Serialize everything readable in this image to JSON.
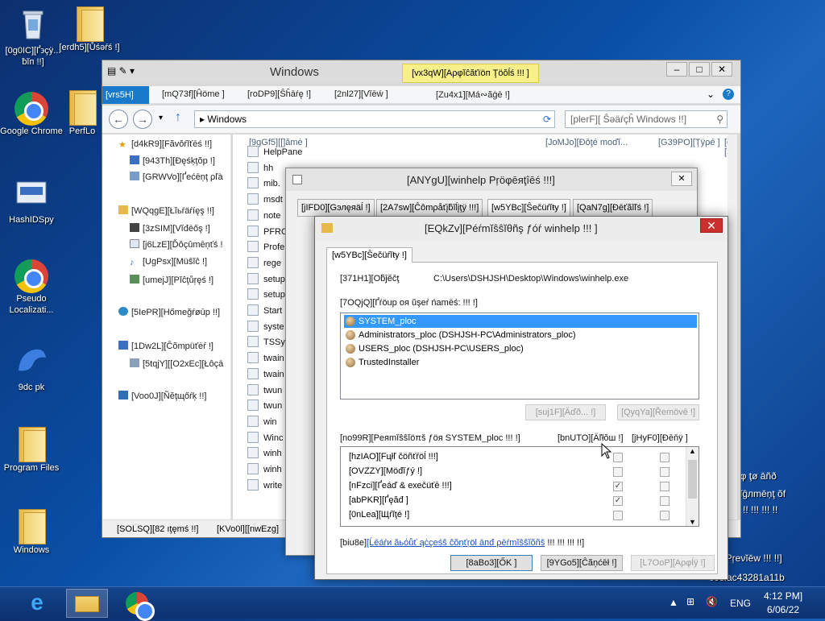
{
  "desktop": {
    "icons": [
      {
        "name": "recycle-bin",
        "label": "[0g0IC][Ґ϶çÿ... ƀĭп !!]"
      },
      {
        "name": "erdh5-folder",
        "label": "[erdh5][Ůśəŕś !]"
      },
      {
        "name": "google-chrome",
        "label": "Google Chrome"
      },
      {
        "name": "perflogs",
        "label": "PerfLo"
      },
      {
        "name": "hashidspy",
        "label": "HashIDSpy"
      },
      {
        "name": "pseudo-localization",
        "label": "Pseudo Localizati..."
      },
      {
        "name": "9dc-pk",
        "label": "9dc pk"
      },
      {
        "name": "program-files",
        "label": "Program Files"
      },
      {
        "name": "windows-folder",
        "label": "Windows"
      }
    ],
    "bg_text_1": "ųφ ţø āñð",
    "bg_text_2": "ŝĭĝлmēņţ õf",
    "bg_text_3": "!! !!! !!! !!",
    "bg_text_4": "ŕáśē Pŗeνĭēw !!! !!]",
    "bg_text_5": "c0cfac43281a11b"
  },
  "explorer": {
    "title": "Windows",
    "context_tab": "[vx3qW][Aρφĭĉăťïöп Ţöŏĺś !!! ]",
    "ribbon_tabs": {
      "file": "[vrs5H][Fĭľэ",
      "home": "[mQ73f][Ĥöme ]",
      "share": "[roDP9][Ŝĥāŕę !]",
      "view": "[2nl27][Vĭēẃ ]",
      "manage": "[Zu4x1][Μá∾ãģē !]"
    },
    "address": "Windows",
    "search_placeholder": "[plerF][ Ŝəäŕçĥ Windows !!]",
    "nav": {
      "favorites": "[d4kR9][Fãvŏŕĭťēś !!]",
      "desktop": "[943Th][Ðęśķţŏр !]",
      "recent": "[GRWVo][Ґećēņţ ρľà",
      "libraries": "[WQqgE][Łĭьŕäŕíęş !!]",
      "videos": "[3zSIM][Vĭđēőş !]",
      "documents": "[j6LzE][Ďôçûmēņťś !",
      "music": "[UgPsx][Мüŝĭĉ !]",
      "pictures": "[umejJ][Ρĭĉţůŗęś !]",
      "homegroup": "[5IePR][Ηőmeğŕøūр !!]",
      "computer": "[1Dw2L][Ĉõmрüťėŕ !]",
      "osc": "[5tqjY][[O2xEc][Łôçā",
      "network": "[Voo0J][Ñĕţщőŕķ !!]"
    },
    "headers": {
      "name": "[9gGf5][[]ămė ]",
      "date": "[JoMJo][Ðǒţé mоďĭ...",
      "type": "[G39PO][Ţÿρé ]",
      "size": "[dogdp][Ŝįźē"
    },
    "files": [
      "HelpPane",
      "hh",
      "mib.",
      "msdt",
      "note",
      "PFRO",
      "Profe",
      "rege",
      "setup",
      "setup",
      "Start",
      "syste",
      "TSSy",
      "twain",
      "twain",
      "twun",
      "twun",
      "win",
      "Winc",
      "winh",
      "winh",
      "write"
    ],
    "status_items": "[SOLSQ][82 ıţęmś !!]",
    "status_selected": "[KVo0l][[nwEzg]"
  },
  "props_dialog": {
    "title": "[ANYgU][winhelp Ρŗöφēяţîēś !!!]",
    "tabs": {
      "general": "[jIFD0][Gэлęяäĺ !]",
      "compat": "[2A7sw][Ĉômρåťįƃĭĺįţÿ !!!]",
      "security": "[w5YBc][Ŝеčüŕĭŧу !]",
      "details": "[QaN7g][Ðēťãĭľś !]"
    },
    "close": "✕"
  },
  "perm_dialog": {
    "title": "[EQkZv][Ρéŕmĭŝŝĭθñş ƒóŕ winhelp !!! ]",
    "tab": "[w5YBc][Ŝеčüŕĭŧу !]",
    "object_label": "[371H1][Οƃĵĕčţ",
    "object_value": "C:\\Users\\DSHJSH\\Desktop\\Windows\\winhelp.exe",
    "groups_label": "[7OQjQ][Ґŕöup оя ŭşеŕ ńаmēś: !!! !]",
    "groups": [
      "SYSTEM_ploc",
      "Administrators_ploc (DSHJSH-PC\\Administrators_ploc)",
      "USERS_ploc (DSHJSH-PC\\USERS_ploc)",
      "TrustedInstaller"
    ],
    "add_button": "[suj1F][Äďð... !]",
    "remove_button": "[QyqYa][Řemövē !]",
    "perms_label": "[no99R][Ρеяmĭŝŝĭöπš ƒöя SYSTEM_ploc !!! !]",
    "allow_label": "[bnUTO][Äľłŏш !]",
    "deny_label": "[jHyF0][Ðēňÿ ]",
    "permissions": [
      {
        "name": "[hzIAO][Fцłľ čöñťŕöĺ !!!]",
        "allow": false,
        "deny": false
      },
      {
        "name": "[OVZZY][Мöđĭƒý !]",
        "allow": false,
        "deny": false
      },
      {
        "name": "[nFzci][Ґeáď & ехеčüťē !!!]",
        "allow": true,
        "deny": false
      },
      {
        "name": "[abPKR][Ґęăđ ]",
        "allow": true,
        "deny": false
      },
      {
        "name": "[0nLea][Щŕĭţé !]",
        "allow": false,
        "deny": false
      }
    ],
    "footer_prefix": "[biu8e]",
    "footer_link": "[Ĺēáŕи ăьόůť ąċçеśŝ ĉõņťŗöl āпđ ρēŕmĭŝŝĭõñš",
    "footer_suffix": " !!! !!! !!! !!]",
    "ok_button": "[8aBo3][ŐΚ ]",
    "cancel_button": "[9YGo5][Ĉãņćēł !]",
    "apply_button": "[L7OoP][Αρφĺÿ !]"
  },
  "taskbar": {
    "lang": "ENG",
    "time": "4:12 ΡΜ]",
    "date": "6/06/22"
  },
  "colors": {
    "selection": "#3399ff",
    "close_red": "#c9302c",
    "link_blue": "#1d4fc4",
    "file_tab_blue": "#1979ca",
    "context_tab_yellow": "#f7ef8a"
  }
}
